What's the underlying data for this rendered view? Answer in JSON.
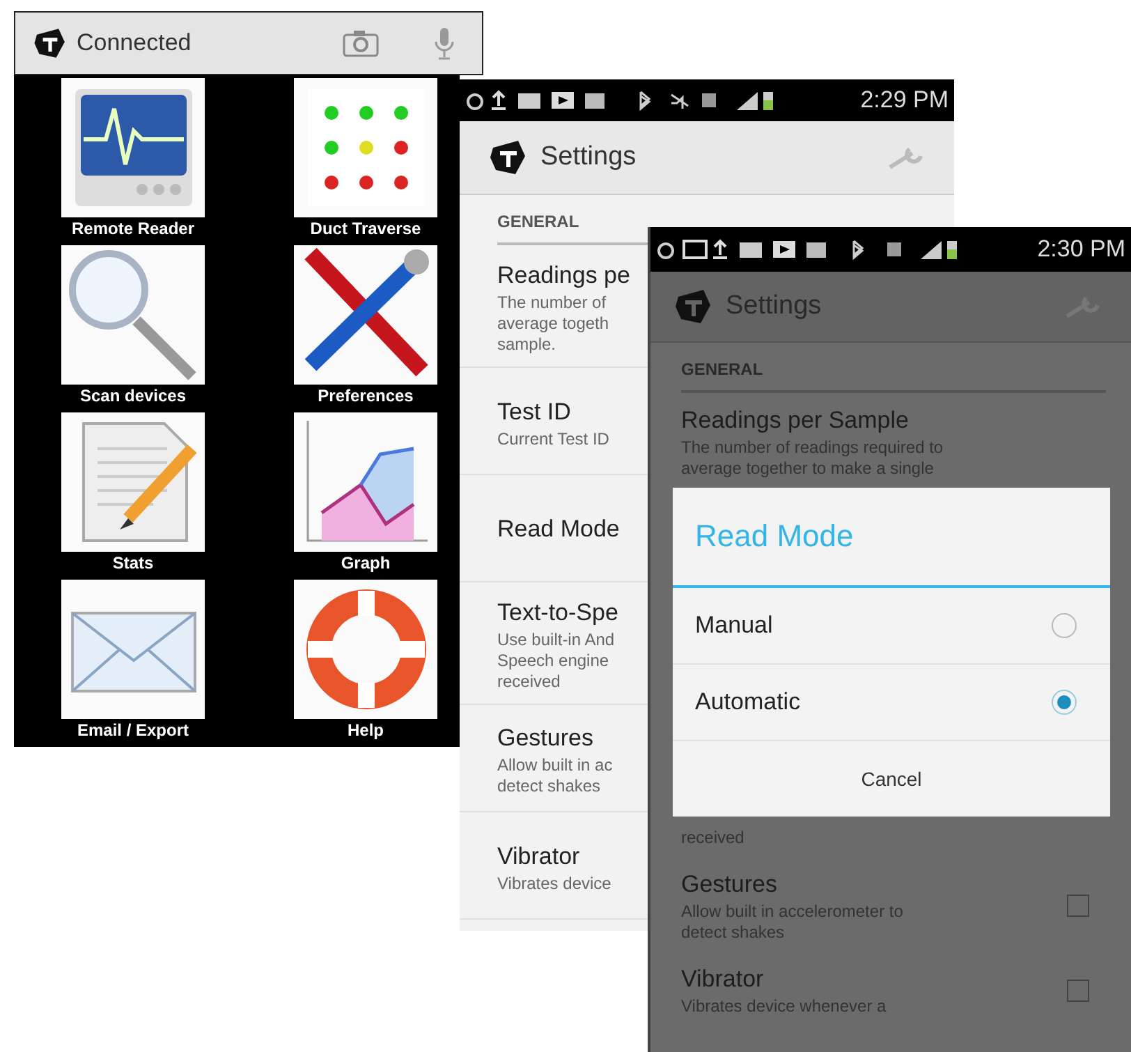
{
  "home_screen": {
    "title": "Connected",
    "tiles": [
      {
        "label": "Remote Reader"
      },
      {
        "label": "Duct Traverse"
      },
      {
        "label": "Scan devices"
      },
      {
        "label": "Preferences"
      },
      {
        "label": "Stats"
      },
      {
        "label": "Graph"
      },
      {
        "label": "Email / Export"
      },
      {
        "label": "Help"
      }
    ]
  },
  "settings_screen": {
    "status_bar": {
      "time": "2:29 PM"
    },
    "title": "Settings",
    "section": "GENERAL",
    "items": [
      {
        "title": "Readings pe",
        "description": [
          "The number of",
          "average togeth",
          "sample."
        ]
      },
      {
        "title": "Test ID",
        "description": [
          "Current Test ID"
        ]
      },
      {
        "title": "Read Mode"
      },
      {
        "title": "Text-to-Spe",
        "description": [
          "Use built-in And",
          "Speech engine",
          "received"
        ]
      },
      {
        "title": "Gestures",
        "description": [
          "Allow built in ac",
          "detect shakes"
        ]
      },
      {
        "title": "Vibrator",
        "description": [
          "Vibrates device"
        ]
      }
    ]
  },
  "settings_screen_dimmed": {
    "status_bar": {
      "time": "2:30 PM"
    },
    "title": "Settings",
    "section": "GENERAL",
    "items_above": [
      {
        "title": "Readings per Sample",
        "description": [
          "The number of readings required to",
          "average together to make a single"
        ]
      }
    ],
    "dialog": {
      "title": "Read Mode",
      "options": [
        {
          "label": "Manual",
          "selected": false
        },
        {
          "label": "Automatic",
          "selected": true
        }
      ],
      "cancel": "Cancel"
    },
    "items_below": [
      {
        "description": [
          "received"
        ]
      },
      {
        "title": "Gestures",
        "description": [
          "Allow built in accelerometer to",
          "detect shakes"
        ],
        "checked": false
      },
      {
        "title": "Vibrator",
        "description": [
          "Vibrates device whenever a"
        ],
        "checked": false
      }
    ]
  }
}
